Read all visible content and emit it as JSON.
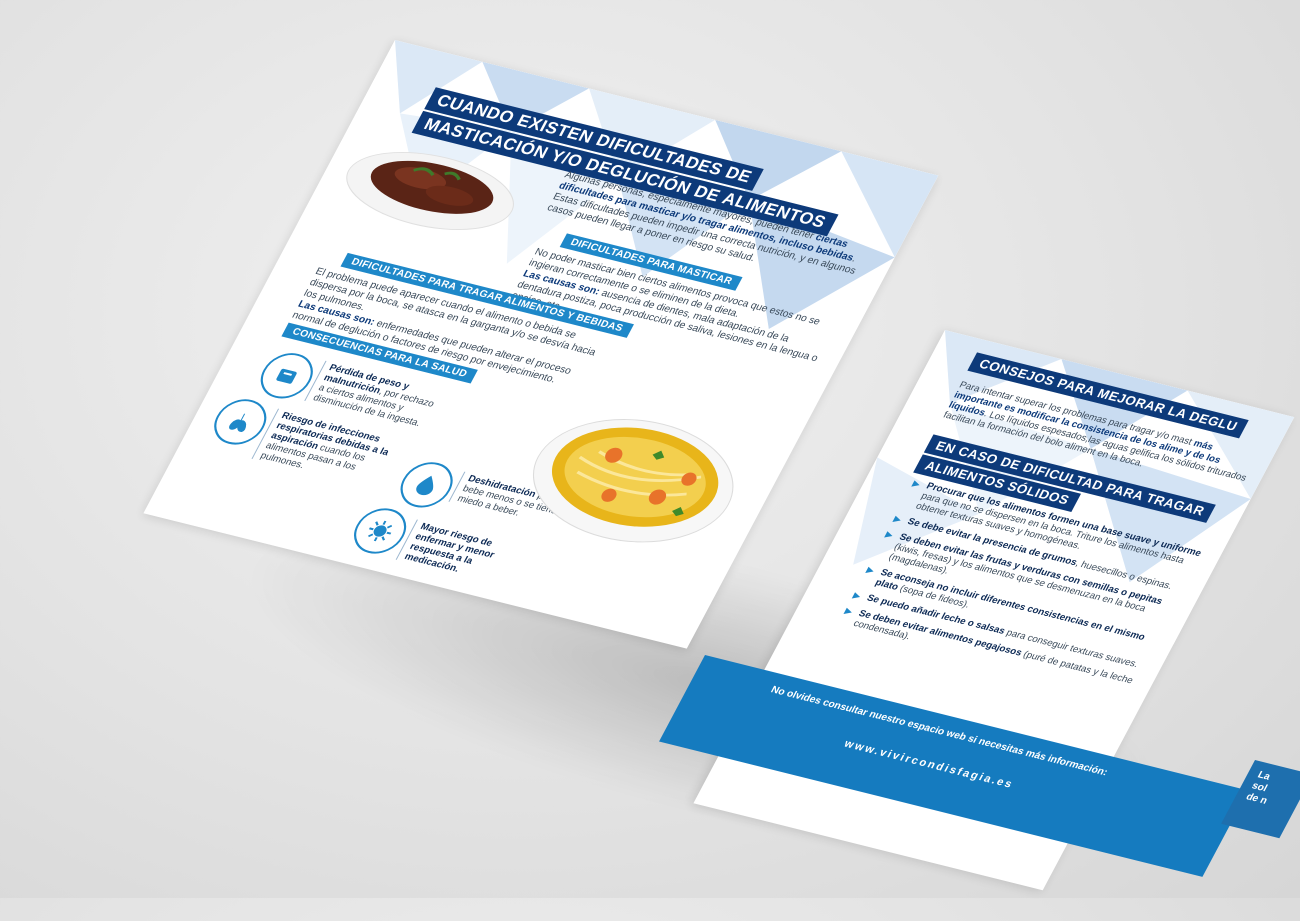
{
  "left": {
    "title_line1": "CUANDO EXISTEN DIFICULTADES DE",
    "title_line2": "MASTICACIÓN Y/O DEGLUCIÓN DE ALIMENTOS",
    "intro_a": "Algunas personas, especialmente mayores, pueden tener ",
    "intro_b": "ciertas dificultades para masticar y/o tragar alimentos, incluso bebidas",
    "intro_c": ". Estas dificultades pueden impedir una correcta nutrición, y en algunos casos pueden llegar a poner en riesgo su salud.",
    "masticar_head": "DIFICULTADES PARA MASTICAR",
    "masticar_text": "No poder masticar bien ciertos alimentos provoca que estos no se ingieran correctamente o se eliminen de la dieta.",
    "masticar_causas_label": "Las causas son:",
    "masticar_causas": " ausencia de dientes, mala adaptación de la dentadura postiza, poca producción de saliva, lesiones en la lengua o encías, etc.",
    "tragar_head": "DIFICULTADES PARA TRAGAR ALIMENTOS Y BEBIDAS",
    "tragar_text": "El problema puede aparecer cuando el alimento o bebida se dispersa por la boca, se atasca en la garganta y/o se desvía hacia los pulmones.",
    "tragar_causas_label": "Las causas son:",
    "tragar_causas": " enfermedades que pueden alterar el proceso normal de deglución o factores de riesgo por envejecimiento.",
    "consecuencias_head": "CONSECUENCIAS PARA LA SALUD",
    "cons": [
      {
        "bold": "Pérdida de peso y malnutrición",
        "text": ", por rechazo a ciertos alimentos y disminución de la ingesta."
      },
      {
        "bold": "Riesgo de infecciones respiratorias debidas a la aspiración",
        "text": " cuando los alimentos pasan a los pulmones."
      },
      {
        "bold": "Deshidratación",
        "text": " porque se bebe menos o se tiene miedo a beber."
      },
      {
        "bold": "Mayor riesgo de enfermar y menor respuesta a la medicación.",
        "text": ""
      }
    ]
  },
  "right": {
    "consejos_head": "CONSEJOS PARA MEJORAR LA DEGLU",
    "consejos_a": "Para intentar superar los problemas para tragar y/o mast",
    "consejos_b": "más importante es modificar la consistencia de los alime",
    "consejos_c": "y de los líquidos",
    "consejos_d": ". Los líquidos espesados,las aguas gelifica los sólidos triturados facilitan la formación del bolo aliment en la boca.",
    "solidos_head1": "EN CASO DE DIFICULTAD PARA TRAGAR",
    "solidos_head2": "ALIMENTOS SÓLIDOS",
    "bullets": [
      {
        "bold": "Procurar que los alimentos formen una base suave y uniforme",
        "text": " para que no se dispersen en la boca. Triture los alimentos hasta obtener texturas suaves y homogéneas."
      },
      {
        "bold": "Se debe evitar la presencia de grumos",
        "text": ", huesecillos o espinas."
      },
      {
        "bold": "Se deben evitar las frutas y verduras con semillas o pepitas",
        "text": " (kiwis, fresas) y los alimentos que se desmenuzan en la boca (magdalenas)."
      },
      {
        "bold": "Se aconseja no incluir diferentes consistencias en el mismo plato",
        "text": " (sopa de fideos)."
      },
      {
        "bold": "Se puedo añadir leche o salsas",
        "text": " para conseguir texturas suaves."
      },
      {
        "bold": "Se deben evitar alimentos pegajosos",
        "text": " (puré de patatas y la leche condensada)."
      }
    ]
  },
  "footer": {
    "text": "No olvides consultar nuestro espacio web si necesitas más información:",
    "url": "www.vivircondisfagia.es"
  },
  "corner": {
    "line1": "La",
    "line2": "sol",
    "line3": "de n"
  },
  "colors": {
    "navy": "#0d3a7a",
    "blue": "#1e88c9",
    "footer_blue": "#157bbf"
  }
}
